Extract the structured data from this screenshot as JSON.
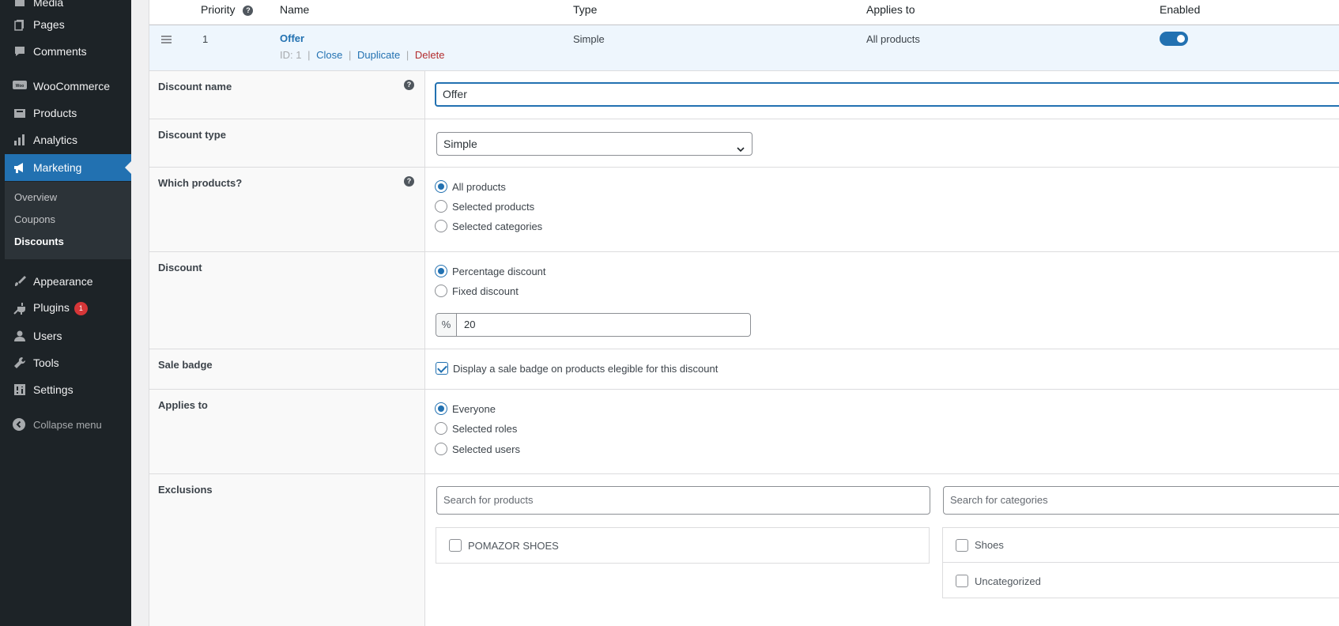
{
  "sidebar": {
    "items": [
      {
        "label": "Media",
        "icon": "media-icon"
      },
      {
        "label": "Pages",
        "icon": "pages-icon"
      },
      {
        "label": "Comments",
        "icon": "comments-icon"
      },
      {
        "label": "WooCommerce",
        "icon": "woocommerce-icon"
      },
      {
        "label": "Products",
        "icon": "products-icon"
      },
      {
        "label": "Analytics",
        "icon": "analytics-icon"
      },
      {
        "label": "Marketing",
        "icon": "megaphone-icon"
      },
      {
        "label": "Appearance",
        "icon": "brush-icon"
      },
      {
        "label": "Plugins",
        "icon": "plug-icon",
        "badge": "1"
      },
      {
        "label": "Users",
        "icon": "user-icon"
      },
      {
        "label": "Tools",
        "icon": "wrench-icon"
      },
      {
        "label": "Settings",
        "icon": "settings-icon"
      }
    ],
    "submenu": [
      "Overview",
      "Coupons",
      "Discounts"
    ],
    "collapse_label": "Collapse menu"
  },
  "table": {
    "headers": {
      "priority": "Priority",
      "name": "Name",
      "type": "Type",
      "applies_to": "Applies to",
      "enabled": "Enabled"
    },
    "row": {
      "priority": "1",
      "name": "Offer",
      "id_label": "ID: 1",
      "close": "Close",
      "duplicate": "Duplicate",
      "delete": "Delete",
      "type": "Simple",
      "applies_to": "All products",
      "enabled": true
    }
  },
  "form": {
    "discount_name": {
      "label": "Discount name",
      "value": "Offer"
    },
    "discount_type": {
      "label": "Discount type",
      "value": "Simple"
    },
    "which_products": {
      "label": "Which products?",
      "options": [
        "All products",
        "Selected products",
        "Selected categories"
      ],
      "selected": 0
    },
    "discount": {
      "label": "Discount",
      "options": [
        "Percentage discount",
        "Fixed discount"
      ],
      "selected": 0,
      "prefix": "%",
      "value": "20"
    },
    "sale_badge": {
      "label": "Sale badge",
      "checkbox_label": "Display a sale badge on products elegible for this discount",
      "checked": true
    },
    "applies_to": {
      "label": "Applies to",
      "options": [
        "Everyone",
        "Selected roles",
        "Selected users"
      ],
      "selected": 0
    },
    "exclusions": {
      "label": "Exclusions",
      "product_search_placeholder": "Search for products",
      "category_search_placeholder": "Search for categories",
      "products": [
        "POMAZOR SHOES"
      ],
      "categories": [
        "Shoes",
        "Uncategorized"
      ]
    }
  },
  "colors": {
    "accent": "#2271b1",
    "sidebar_bg": "#1d2327",
    "delete": "#b32d2e"
  }
}
